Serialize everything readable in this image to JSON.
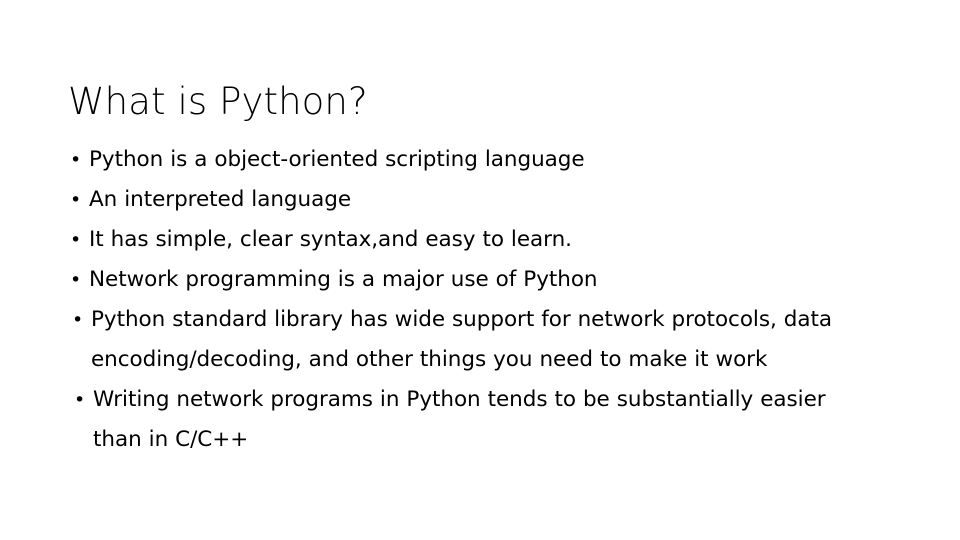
{
  "slide": {
    "title": "What is Python?",
    "background_color": "#ffffff",
    "text_color": "#000000",
    "bullet_glyph": "•",
    "bullets": [
      {
        "lines": [
          "Python is a object-oriented scripting language"
        ]
      },
      {
        "lines": [
          "An interpreted language"
        ]
      },
      {
        "lines": [
          "It has simple, clear syntax,and easy to learn."
        ]
      },
      {
        "lines": [
          "Network programming is a major use of Python"
        ]
      },
      {
        "lines": [
          "Python standard library has wide support for network protocols, data",
          "encoding/decoding, and other things you need to make it work"
        ]
      },
      {
        "lines": [
          "Writing network programs in Python tends to be substantially easier",
          "than in C/C++"
        ]
      }
    ]
  }
}
